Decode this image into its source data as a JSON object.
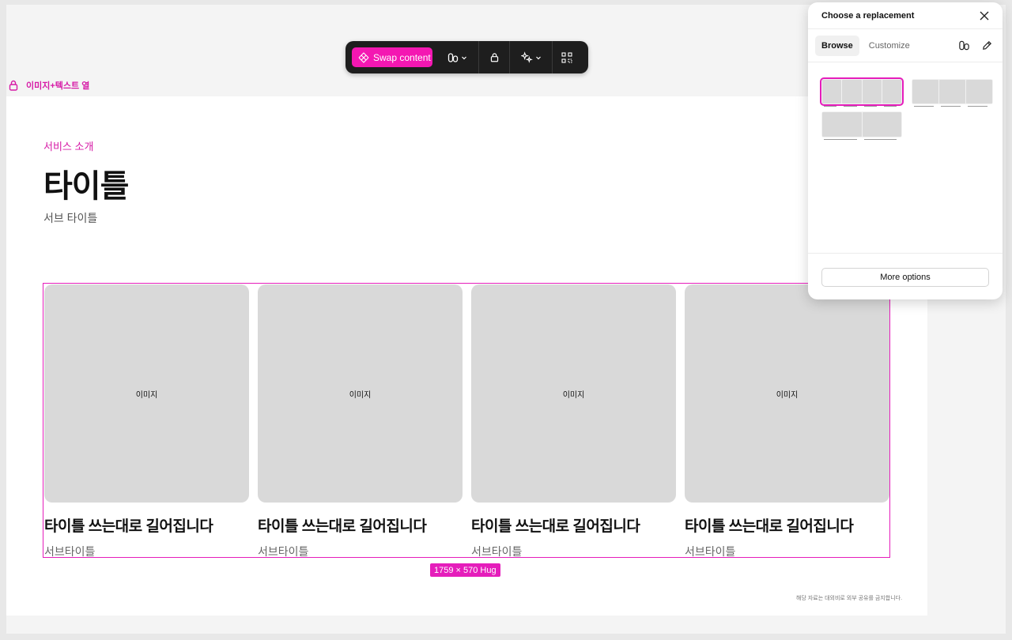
{
  "frame": {
    "label": "이미지+텍스트 열"
  },
  "toolbar": {
    "swap_label": "Swap content",
    "icons": [
      "swap-icon",
      "variants-icon",
      "chevron-down-icon",
      "lock-icon",
      "sparkle-icon",
      "chevron-down-icon",
      "grid-icon"
    ]
  },
  "content": {
    "eyebrow": "서비스 소개",
    "title": "타이틀",
    "subtitle": "서브 타이틀",
    "cards": [
      {
        "image_label": "이미지",
        "title": "타이틀 쓰는대로 길어집니다",
        "subtitle": "서브타이틀"
      },
      {
        "image_label": "이미지",
        "title": "타이틀 쓰는대로 길어집니다",
        "subtitle": "서브타이틀"
      },
      {
        "image_label": "이미지",
        "title": "타이틀 쓰는대로 길어집니다",
        "subtitle": "서브타이틀"
      },
      {
        "image_label": "이미지",
        "title": "타이틀 쓰는대로 길어집니다",
        "subtitle": "서브타이틀"
      }
    ],
    "footer_note": "해당 자료는 대외비로 외부 공유를 금지합니다."
  },
  "selection": {
    "size_label": "1759 × 570 Hug"
  },
  "panel": {
    "title": "Choose a replacement",
    "tabs": [
      {
        "label": "Browse",
        "active": true
      },
      {
        "label": "Customize",
        "active": false
      }
    ],
    "options": [
      {
        "columns": 4,
        "selected": true
      },
      {
        "columns": 3,
        "selected": false
      },
      {
        "columns": 2,
        "selected": false
      }
    ],
    "more_options_label": "More options"
  },
  "colors": {
    "accent": "#e51dbb",
    "swap_button": "#f417b2",
    "toolbar_bg": "#1e1e1e",
    "image_placeholder": "#d9d9d9"
  }
}
